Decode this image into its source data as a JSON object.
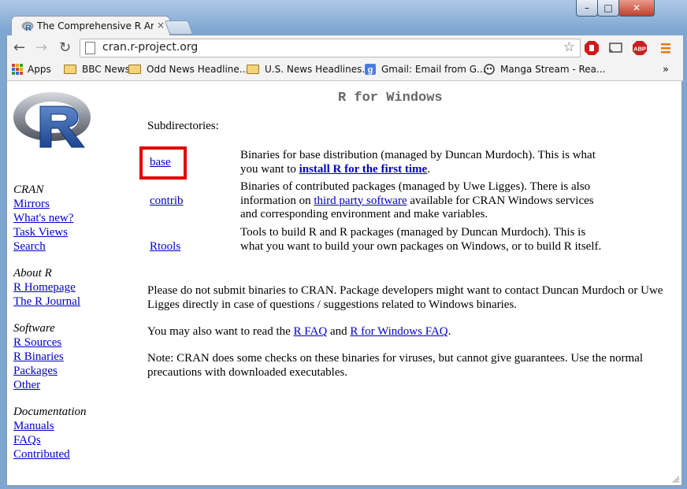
{
  "browser": {
    "tab_title": "The Comprehensive R Arc",
    "tab_close": "×",
    "url": "cran.r-project.org",
    "window_controls": {
      "minimize": "–",
      "maximize": "□",
      "close": "✕"
    }
  },
  "bookmarks": [
    {
      "label": "Apps",
      "icon": "apps-grid-icon"
    },
    {
      "label": "BBC News",
      "icon": "folder-icon"
    },
    {
      "label": "Odd News Headline...",
      "icon": "folder-icon"
    },
    {
      "label": "U.S. News Headlines...",
      "icon": "folder-icon"
    },
    {
      "label": "Gmail: Email from G...",
      "icon": "google-icon"
    },
    {
      "label": "Manga Stream - Rea...",
      "icon": "manga-stream-icon"
    }
  ],
  "bookmarks_more": "»",
  "extensions": {
    "abp_label": "ABP"
  },
  "sidebar": {
    "sections": [
      {
        "heading": "CRAN",
        "links": [
          "Mirrors",
          "What's new?",
          "Task Views",
          "Search"
        ]
      },
      {
        "heading": "About R",
        "links": [
          "R Homepage",
          "The R Journal"
        ]
      },
      {
        "heading": "Software",
        "links": [
          "R Sources",
          "R Binaries",
          "Packages",
          "Other"
        ]
      },
      {
        "heading": "Documentation",
        "links": [
          "Manuals",
          "FAQs",
          "Contributed"
        ]
      }
    ]
  },
  "main": {
    "title": "R for Windows",
    "subdirectories_label": "Subdirectories:",
    "directories": [
      {
        "link": "base",
        "desc_before": "Binaries for base distribution (managed by Duncan Murdoch). This is what you want to ",
        "desc_link": "install R for the first time",
        "desc_after": "."
      },
      {
        "link": "contrib",
        "desc_before": "Binaries of contributed packages (managed by Uwe Ligges). There is also information on ",
        "desc_link": "third party software",
        "desc_after": " available for CRAN Windows services and corresponding environment and make variables."
      },
      {
        "link": "Rtools",
        "desc_before": "Tools to build R and R packages (managed by Duncan Murdoch). This is what you want to build your own packages on Windows, or to build R itself.",
        "desc_link": "",
        "desc_after": ""
      }
    ],
    "para1": "Please do not submit binaries to CRAN. Package developers might want to contact Duncan Murdoch or Uwe Ligges directly in case of questions / suggestions related to Windows binaries.",
    "para2_before": "You may also want to read the ",
    "para2_link1": "R FAQ",
    "para2_mid": " and ",
    "para2_link2": "R for Windows FAQ",
    "para2_after": ".",
    "para3": "Note: CRAN does some checks on these binaries for viruses, but cannot give guarantees. Use the normal precautions with downloaded executables."
  },
  "colors": {
    "link": "#0000cc",
    "highlight_box": "#e00000",
    "title_gray": "#666666"
  }
}
